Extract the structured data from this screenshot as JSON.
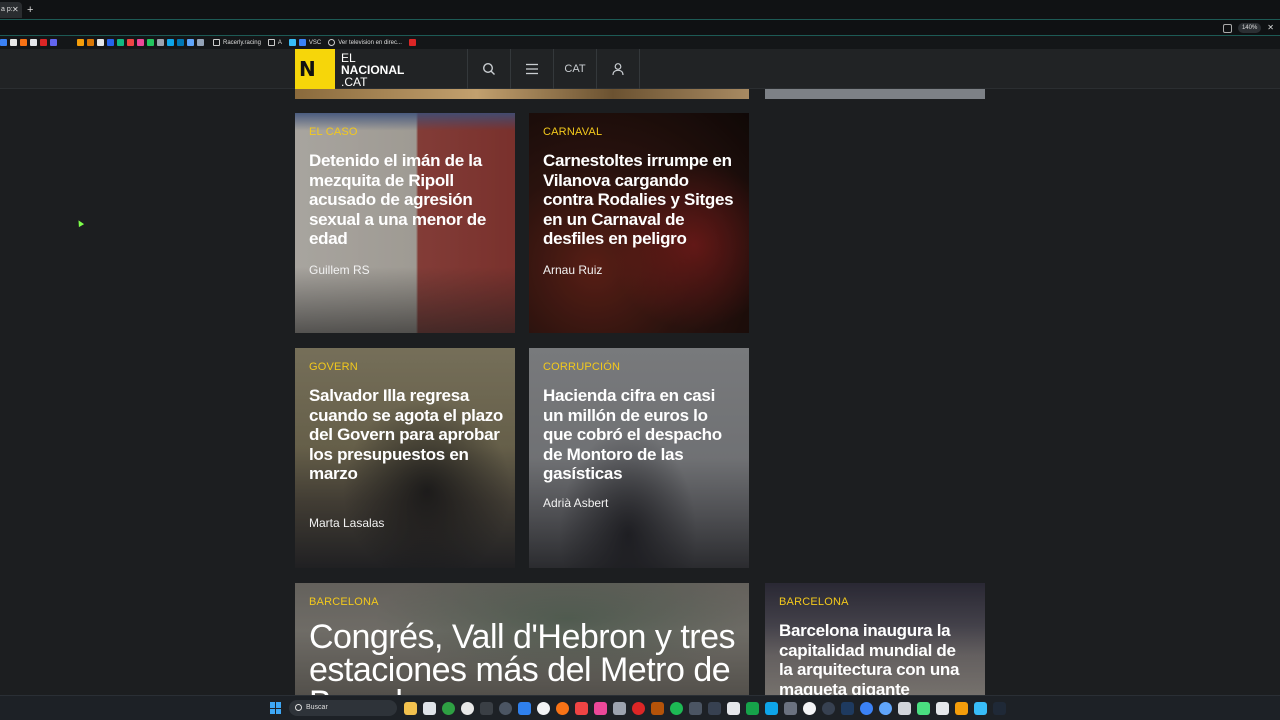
{
  "browser": {
    "tab_label": "a p:",
    "tab_close": "✕",
    "new_tab": "+",
    "zoom": "140%",
    "bookmarks": [
      {
        "label": "Racerly.racing",
        "icon": "folder-icon"
      },
      {
        "label": "A",
        "icon": "folder-icon"
      },
      {
        "label": "VSC",
        "icon": "vscode-icon"
      },
      {
        "label": "Ver television en direc...",
        "icon": "globe-icon"
      }
    ]
  },
  "header": {
    "logo_letter": "N",
    "logo_line1": "EL",
    "logo_line2": "NACIONAL",
    "logo_line3": ".CAT",
    "lang": "CAT"
  },
  "articles": [
    {
      "category": "EL CASO",
      "title": "Detenido el imán de la mezquita de Ripoll acusado de agresión sexual a una menor de edad",
      "author": "Guillem RS"
    },
    {
      "category": "CARNAVAL",
      "title": "Carnestoltes irrumpe en Vilanova cargando contra Rodalies y Sitges en un Carnaval de desfiles en peligro",
      "author": "Arnau Ruiz"
    },
    {
      "category": "GOVERN",
      "title": "Salvador Illa regresa cuando se agota el plazo del Govern para aprobar los presupuestos en marzo",
      "author": "Marta Lasalas"
    },
    {
      "category": "CORRUPCIÓN",
      "title": "Hacienda cifra en casi un millón de euros lo que cobró el despacho de Montoro de las gasísticas",
      "author": "Adrià Asbert"
    },
    {
      "category": "BARCELONA",
      "title": "Congrés, Vall d'Hebron y tres estaciones más del Metro de Barcelona",
      "author": ""
    },
    {
      "category": "BARCELONA",
      "title": "Barcelona inaugura la capitalidad mundial de la arquitectura con una maqueta gigante",
      "author": ""
    }
  ],
  "taskbar": {
    "search_placeholder": "Buscar"
  },
  "colors": {
    "accent_yellow": "#f6d60a",
    "category_yellow": "#f3c91c",
    "page_bg": "#1c1e20"
  }
}
